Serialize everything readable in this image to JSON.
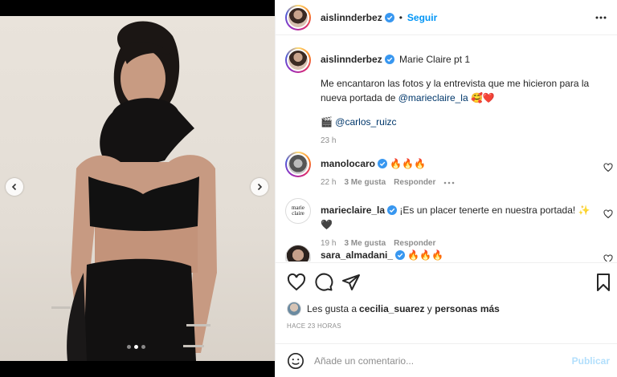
{
  "header": {
    "username": "aislinnderbez",
    "follow_label": "Seguir"
  },
  "caption": {
    "username": "aislinnderbez",
    "title": "Marie Claire pt 1",
    "text_line1": "Me encantaron las fotos y la entrevista que me hicieron para la",
    "text_line2_prefix": "nueva portada de ",
    "mention": "@marieclaire_la",
    "emojis": "🥰❤️",
    "credit_icon": "🎬",
    "credit": "@carlos_ruizc",
    "time": "23 h"
  },
  "comments": [
    {
      "username": "manolocaro",
      "text": "🔥🔥🔥",
      "time": "22 h",
      "likes": "3 Me gusta",
      "reply": "Responder"
    },
    {
      "username": "marieclaire_la",
      "avatar_text": "marie claire",
      "text": "¡Es un placer tenerte en nuestra portada! ✨🖤",
      "time": "19 h",
      "likes": "3 Me gusta",
      "reply": "Responder"
    },
    {
      "username": "sara_almadani_",
      "text": "🔥🔥🔥"
    }
  ],
  "likes": {
    "prefix": "Les gusta a ",
    "user": "cecilia_suarez",
    "middle": " y ",
    "others": "personas más"
  },
  "timestamp": "HACE 23 HORAS",
  "add_comment": {
    "placeholder": "Añade un comentario...",
    "publish_label": "Publicar"
  },
  "carousel": {
    "dots": 3,
    "active_index": 1
  },
  "colors": {
    "accent": "#0095f6",
    "publish_disabled": "#b2dffc",
    "meta": "#8e8e8e"
  }
}
